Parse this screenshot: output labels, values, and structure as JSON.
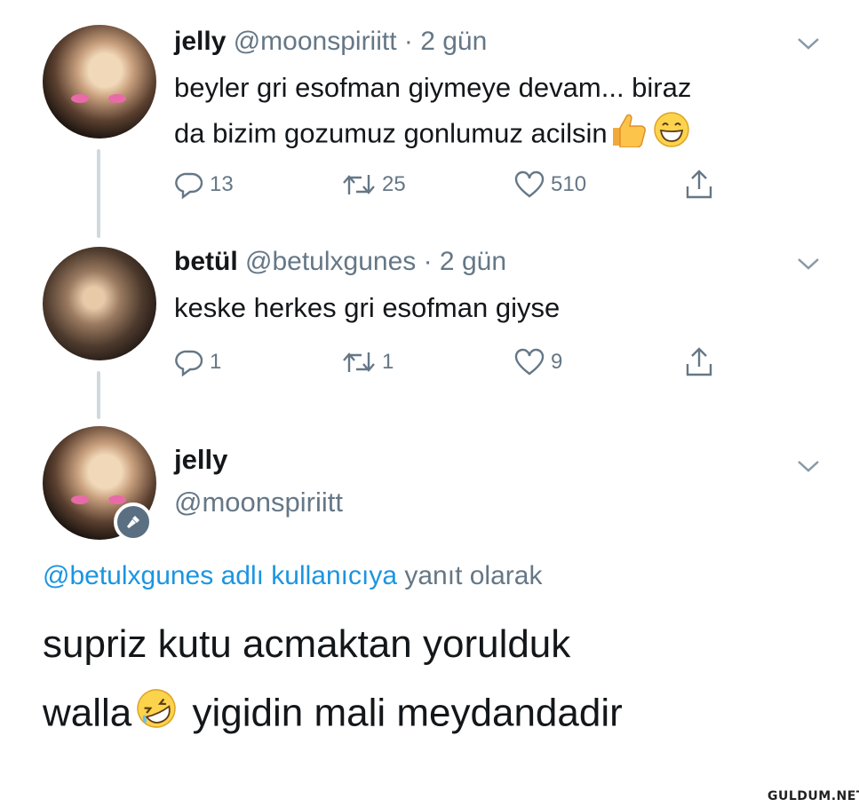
{
  "tweet1": {
    "name": "jelly",
    "handle": "@moonspiriitt",
    "time": "· 2 gün",
    "text_line1": "beyler gri esofman giymeye devam... biraz",
    "text_line2": "da bizim gozumuz gonlumuz acilsin",
    "replies": "13",
    "retweets": "25",
    "likes": "510"
  },
  "tweet2": {
    "name": "betül",
    "handle": "@betulxgunes",
    "time": "· 2 gün",
    "text": "keske herkes gri esofman giyse",
    "replies": "1",
    "retweets": "1",
    "likes": "9"
  },
  "tweet3": {
    "name": "jelly",
    "handle": "@moonspiriitt",
    "reply_mention": "@betulxgunes adlı kullanıcıya",
    "reply_suffix": "yanıt olarak",
    "text_line1": "supriz kutu acmaktan yorulduk",
    "text_line2a": "walla",
    "text_line2b": "yigidin mali meydandadir"
  },
  "watermark": "GULDUM.NET",
  "icons": [
    "reply-icon",
    "retweet-icon",
    "like-icon",
    "share-icon",
    "chevron-down-icon",
    "mic-icon",
    "thumbs-up-emoji",
    "grin-emoji",
    "rofl-emoji"
  ],
  "colors": {
    "link": "#1b95e0",
    "muted": "#657786",
    "text": "#14171a",
    "line": "#cfd9de"
  }
}
